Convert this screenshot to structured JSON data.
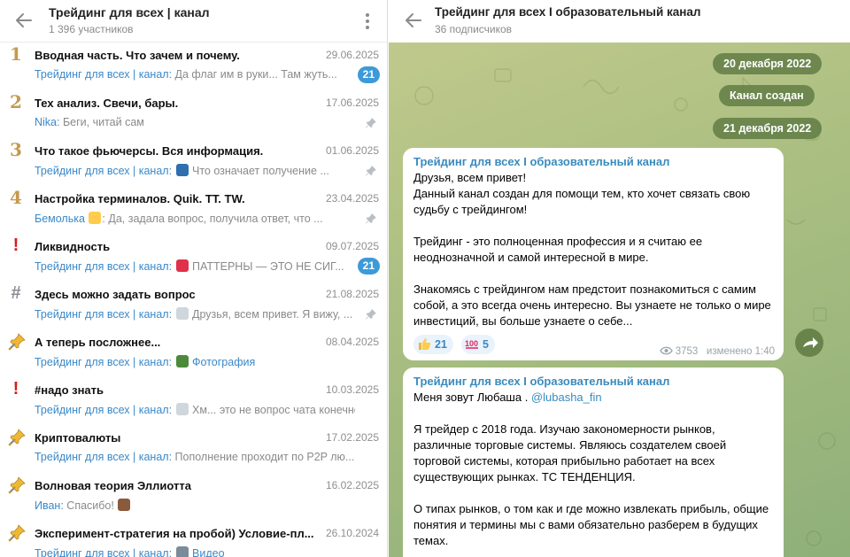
{
  "left": {
    "title": "Трейдинг для всех | канал",
    "subtitle": "1 396 участников",
    "topics": [
      {
        "icon_type": "num",
        "icon_text": "1",
        "name": "Вводная часть. Что зачем и почему.",
        "date": "29.06.2025",
        "sender": "Трейдинг для всех | канал:",
        "preview": " Да флаг им в руки... Там жуть...",
        "badge": "21",
        "pinned": false
      },
      {
        "icon_type": "num",
        "icon_text": "2",
        "name": "Тех анализ. Свечи, бары.",
        "date": "17.06.2025",
        "sender": "Nika:",
        "preview": " Беги, читай сам",
        "badge": "",
        "pinned": true
      },
      {
        "icon_type": "num",
        "icon_text": "3",
        "name": "Что такое фьючерсы. Вся информация.",
        "date": "01.06.2025",
        "sender": "Трейдинг для всех | канал:",
        "preview": " Что означает получение ...",
        "badge": "",
        "pinned": true,
        "emoji": "chart-icon"
      },
      {
        "icon_type": "num",
        "icon_text": "4",
        "name": "Настройка терминалов. Quik. TT. TW.",
        "date": "23.04.2025",
        "sender": "Бемолька",
        "preview": ": Да, задала вопрос, получила ответ, что ...",
        "badge": "",
        "pinned": true,
        "emoji": "party-face-sun-icon"
      },
      {
        "icon_type": "excl",
        "icon_text": "!",
        "name": "Ликвидность",
        "date": "09.07.2025",
        "sender": "Трейдинг для всех | канал:",
        "preview": " ПАТТЕРНЫ — ЭТО НЕ СИГ...",
        "badge": "21",
        "pinned": false,
        "emoji": "pushpin-icon"
      },
      {
        "icon_type": "hash",
        "icon_text": "#",
        "name": "Здесь можно задать вопрос",
        "date": "21.08.2025",
        "sender": "Трейдинг для всех | канал:",
        "preview": " Друзья, всем привет. Я вижу, ...",
        "badge": "",
        "pinned": true,
        "emoji": "image-thumb-icon"
      },
      {
        "icon_type": "pin",
        "icon_text": "",
        "name": "А теперь посложнее...",
        "date": "08.04.2025",
        "sender": "Трейдинг для всех | канал:",
        "preview": " Фотография",
        "badge": "",
        "pinned": false,
        "emoji": "forward-photo-icon",
        "preview_blue": true
      },
      {
        "icon_type": "excl",
        "icon_text": "!",
        "name": "#надо знать",
        "date": "10.03.2025",
        "sender": "Трейдинг для всех | канал:",
        "preview": " Хм... это не вопрос чата конечно...",
        "badge": "",
        "pinned": false,
        "emoji": "image-thumb-icon"
      },
      {
        "icon_type": "pin",
        "icon_text": "",
        "name": "Криптовалюты",
        "date": "17.02.2025",
        "sender": "Трейдинг для всех | канал:",
        "preview": " Пополнение проходит по P2P лю...",
        "badge": "",
        "pinned": false
      },
      {
        "icon_type": "pin",
        "icon_text": "",
        "name": "Волновая теория Эллиотта",
        "date": "16.02.2025",
        "sender": "Иван:",
        "preview": " Спасибо! ",
        "badge": "",
        "pinned": false,
        "emoji": "praying-hands-icon"
      },
      {
        "icon_type": "pin",
        "icon_text": "",
        "name": "Эксперимент-стратегия на пробой) Условие-пл...",
        "date": "26.10.2024",
        "sender": "Трейдинг для всех | канал:",
        "preview": " Видео",
        "badge": "",
        "pinned": false,
        "emoji": "forward-video-icon",
        "preview_blue": true
      }
    ]
  },
  "right": {
    "title": "Трейдинг для всех I образовательный канал",
    "subtitle": "36 подписчиков",
    "pills": {
      "date1": "20 декабря 2022",
      "created": "Канал создан",
      "date2": "21 декабря 2022"
    },
    "msg1": {
      "channel": "Трейдинг для всех I образовательный канал",
      "body": "Друзья, всем привет!\nДанный канал создан для помощи тем, кто хочет связать свою судьбу с трейдингом!\n\nТрейдинг - это полноценная профессия и я считаю ее неоднозначной и самой интересной в мире.\n\nЗнакомясь с трейдингом нам предстоит познакомиться с самим собой,  а это всегда очень интересно. Вы узнаете не только о мире инвестиций, вы больше узнаете о себе...",
      "reactions": [
        {
          "icon": "thumbs-up-icon",
          "count": "21"
        },
        {
          "icon": "hundred-points-icon",
          "count": "5"
        }
      ],
      "views": "3753",
      "edited": "изменено 1:40"
    },
    "msg2": {
      "channel": "Трейдинг для всех I образовательный канал",
      "intro": "Меня зовут Любаша . ",
      "mention": "@lubasha_fin",
      "body": "\n\nЯ трейдер с 2018 года. Изучаю закономерности рынков, различные торговые системы. Являюсь создателем своей торговой системы, которая прибыльно работает на всех существующих рынках.  ТС ТЕНДЕНЦИЯ.\n\nО типах рынков, о том как и где можно извлекать прибыль, общие понятия и термины мы с вами обязательно разберем в будущих темах."
    }
  },
  "colors": {
    "accent": "#3d9ad9",
    "link": "#3a8bbd",
    "number": "#c49a4e",
    "alert": "#d41e1e",
    "chat_bg": "#a8bd80",
    "pill": "#5e7a42"
  }
}
